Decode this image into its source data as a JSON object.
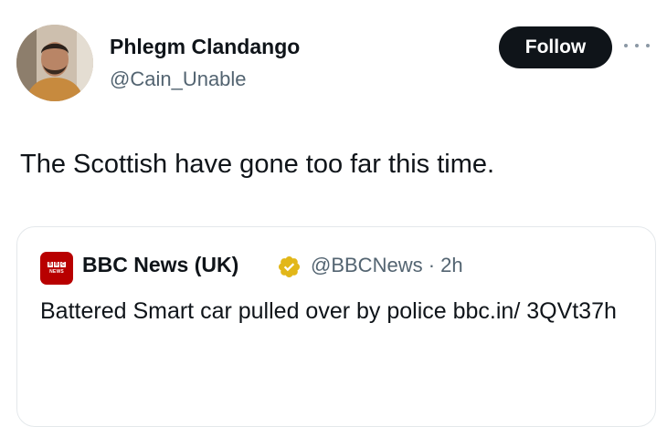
{
  "author": {
    "name": "Phlegm Clandango",
    "handle": "@Cain_Unable"
  },
  "actions": {
    "follow_label": "Follow",
    "more_icon": "more-horizontal-icon"
  },
  "tweet": {
    "text": "The Scottish have gone too far this time."
  },
  "quoted_tweet": {
    "logo_text": "NEWS",
    "logo_letters": [
      "B",
      "B",
      "C"
    ],
    "name": "BBC News (UK)",
    "verified_icon": "verified-badge-icon",
    "handle": "@BBCNews",
    "separator": "·",
    "time": "2h",
    "text": "Battered Smart car pulled over by police bbc.in/ 3QVt37h"
  },
  "colors": {
    "follow_bg": "#0f1419",
    "handle_gray": "#536471",
    "verified_gold": "#e2b719",
    "bbc_red": "#b80000"
  }
}
